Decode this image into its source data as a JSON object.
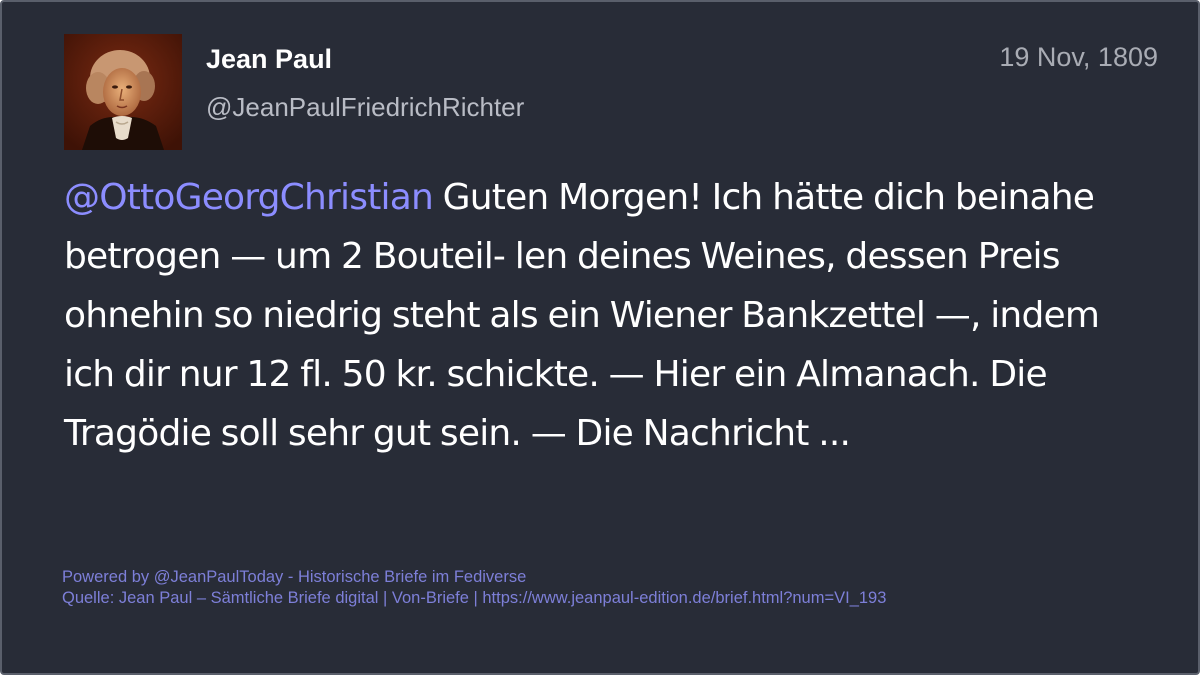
{
  "post": {
    "author": {
      "display_name": "Jean Paul",
      "handle": "@JeanPaulFriedrichRichter"
    },
    "timestamp": "19 Nov, 1809",
    "mention": "@OttoGeorgChristian",
    "body": " Guten Morgen! Ich hätte dich beinahe betrogen — um 2 Bouteil- len deines Weines, dessen Preis ohnehin so niedrig steht als ein Wiener Bankzettel —, indem ich dir nur 12 fl. 50 kr. schickte. — Hier ein Almanach. Die Tragödie soll sehr gut sein. — Die Nachricht ..."
  },
  "footer": {
    "powered_by": "Powered by @JeanPaulToday - Historische Briefe im Fediverse",
    "source": "Quelle: Jean Paul – Sämtliche Briefe digital | Von-Briefe | https://www.jeanpaul-edition.de/brief.html?num=VI_193"
  },
  "colors": {
    "background": "#282c37",
    "mention": "#8c8dff",
    "footer_text": "#7d7fd8",
    "name_text": "#ffffff",
    "muted_text": "#a9acb4"
  }
}
